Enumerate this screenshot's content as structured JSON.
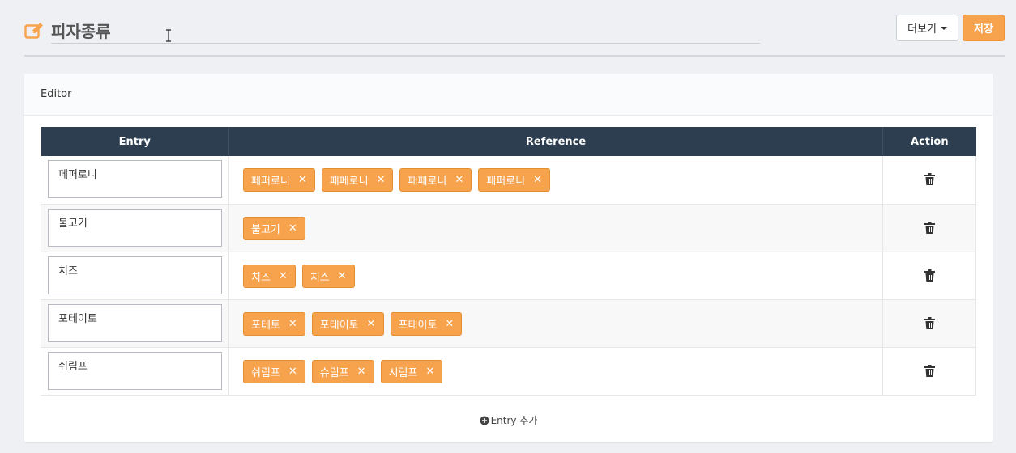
{
  "header": {
    "title": "피자종류",
    "more_label": "더보기",
    "save_label": "저장"
  },
  "card": {
    "title": "Editor"
  },
  "table": {
    "columns": [
      "Entry",
      "Reference",
      "Action"
    ],
    "rows": [
      {
        "entry": "페퍼로니",
        "references": [
          "페퍼로니",
          "페페로니",
          "패패로니",
          "패퍼로니"
        ]
      },
      {
        "entry": "불고기",
        "references": [
          "불고기"
        ]
      },
      {
        "entry": "치즈",
        "references": [
          "치즈",
          "치스"
        ]
      },
      {
        "entry": "포테이토",
        "references": [
          "포테토",
          "포테이토",
          "포태이토"
        ]
      },
      {
        "entry": "쉬림프",
        "references": [
          "쉬림프",
          "슈림프",
          "시림프"
        ]
      }
    ]
  },
  "add_entry_label": "Entry 추가",
  "icons": {
    "title": "edit-icon",
    "action": "trash-icon",
    "add": "plus-circle-icon",
    "remove_tag": "close-icon"
  },
  "colors": {
    "accent": "#f7a24d",
    "table_header": "#2c3e50"
  }
}
